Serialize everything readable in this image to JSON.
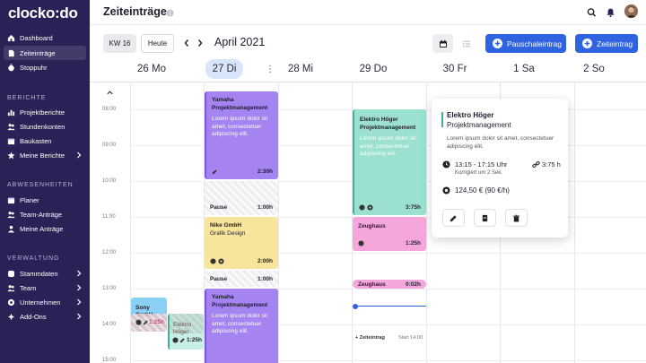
{
  "app": {
    "logo": "clocko:do"
  },
  "sidebar": {
    "main": [
      {
        "label": "Dashboard",
        "icon": "home-icon"
      },
      {
        "label": "Zeiteinträge",
        "icon": "file-icon",
        "active": true
      },
      {
        "label": "Stoppuhr",
        "icon": "stopwatch-icon"
      }
    ],
    "sections": [
      {
        "title": "BERICHTE",
        "items": [
          {
            "label": "Projektberichte",
            "icon": "chart-icon"
          },
          {
            "label": "Stundenkonten",
            "icon": "users-icon"
          },
          {
            "label": "Baukasten",
            "icon": "box-icon"
          },
          {
            "label": "Meine Berichte",
            "icon": "star-icon",
            "chevron": true
          }
        ]
      },
      {
        "title": "ABWESENHEITEN",
        "items": [
          {
            "label": "Planer",
            "icon": "calendar-icon"
          },
          {
            "label": "Team-Anträge",
            "icon": "team-requests-icon"
          },
          {
            "label": "Meine Anträge",
            "icon": "my-requests-icon"
          }
        ]
      },
      {
        "title": "VERWALTUNG",
        "items": [
          {
            "label": "Stammdaten",
            "icon": "database-icon",
            "chevron": true
          },
          {
            "label": "Team",
            "icon": "team-icon",
            "chevron": true
          },
          {
            "label": "Unternehmen",
            "icon": "building-icon",
            "chevron": true
          },
          {
            "label": "Add-Ons",
            "icon": "puzzle-icon",
            "chevron": true
          }
        ]
      }
    ]
  },
  "header": {
    "title": "Zeiteinträge"
  },
  "toolbar": {
    "week": "KW 16",
    "today": "Heute",
    "month": "April 2021",
    "flat_entry": "Pauschaleintrag",
    "time_entry": "Zeiteintrag"
  },
  "days": [
    {
      "label": "26 Mo"
    },
    {
      "label": "27 Di",
      "today": true
    },
    {
      "label": "28 Mi"
    },
    {
      "label": "29 Do"
    },
    {
      "label": "30 Fr"
    },
    {
      "label": "1 Sa"
    },
    {
      "label": "2 So"
    }
  ],
  "times": [
    "08:00",
    "09:00",
    "10:00",
    "11:00",
    "12:00",
    "13:00",
    "14:00",
    "15:00"
  ],
  "events": {
    "tue_yamaha_1": {
      "title": "Yamaha",
      "subtitle": "Projektmanagement",
      "desc": "Lorem ipsum dolor sit amet, consectetuer adipiscing elit.",
      "duration": "2:30h"
    },
    "tue_pause_1": {
      "title": "Pause",
      "duration": "1:00h"
    },
    "tue_nike": {
      "title": "Nike GmbH",
      "subtitle": "Grafik Design",
      "duration": "2:00h"
    },
    "tue_pause_2": {
      "title": "Pause",
      "duration": "1:00h"
    },
    "tue_yamaha_2": {
      "title": "Yamaha",
      "subtitle": "Projektmanagement",
      "desc": "Lorem ipsum dolor sit amet, consectetuer adipiscing elit."
    },
    "mon_sony": {
      "title": "Sony GmbH",
      "duration": "1:25h"
    },
    "mon_elektro": {
      "title": "Elektro Höger",
      "duration": "1:25h"
    },
    "thu_elektro": {
      "title": "Elektro Höger",
      "subtitle": "Projektmanagement",
      "desc": "Lorem ipsum dolor sit amet, consectetuer adipiscing elit.",
      "duration": "3:75h"
    },
    "thu_zeughaus": {
      "title": "Zeughaus",
      "duration": "1:25h"
    },
    "thu_zeughaus_2": {
      "title": "Zeughaus",
      "duration": "0:02h"
    }
  },
  "thursday": {
    "add_entry": "+ Zeiteintrag",
    "start": "Start 14:00"
  },
  "popover": {
    "title": "Elektro Höger",
    "subtitle": "Projektmanagement",
    "desc": "Lorem ipsum dolor sit amet, consectetuer adipiscing elit.",
    "time": "13:15 - 17:15 Uhr",
    "duration": "3:75 h",
    "corrected": "Korrigiert um 2 Sek.",
    "price": "124,50 € (90 €/h)"
  },
  "colors": {
    "sidebar": "#2a2257",
    "primary": "#2f63e0",
    "purple": "#a583f0",
    "teal": "#9be0d0",
    "pink": "#f5a7dc",
    "yellow": "#f7e59c",
    "blue": "#8ad0f5"
  }
}
